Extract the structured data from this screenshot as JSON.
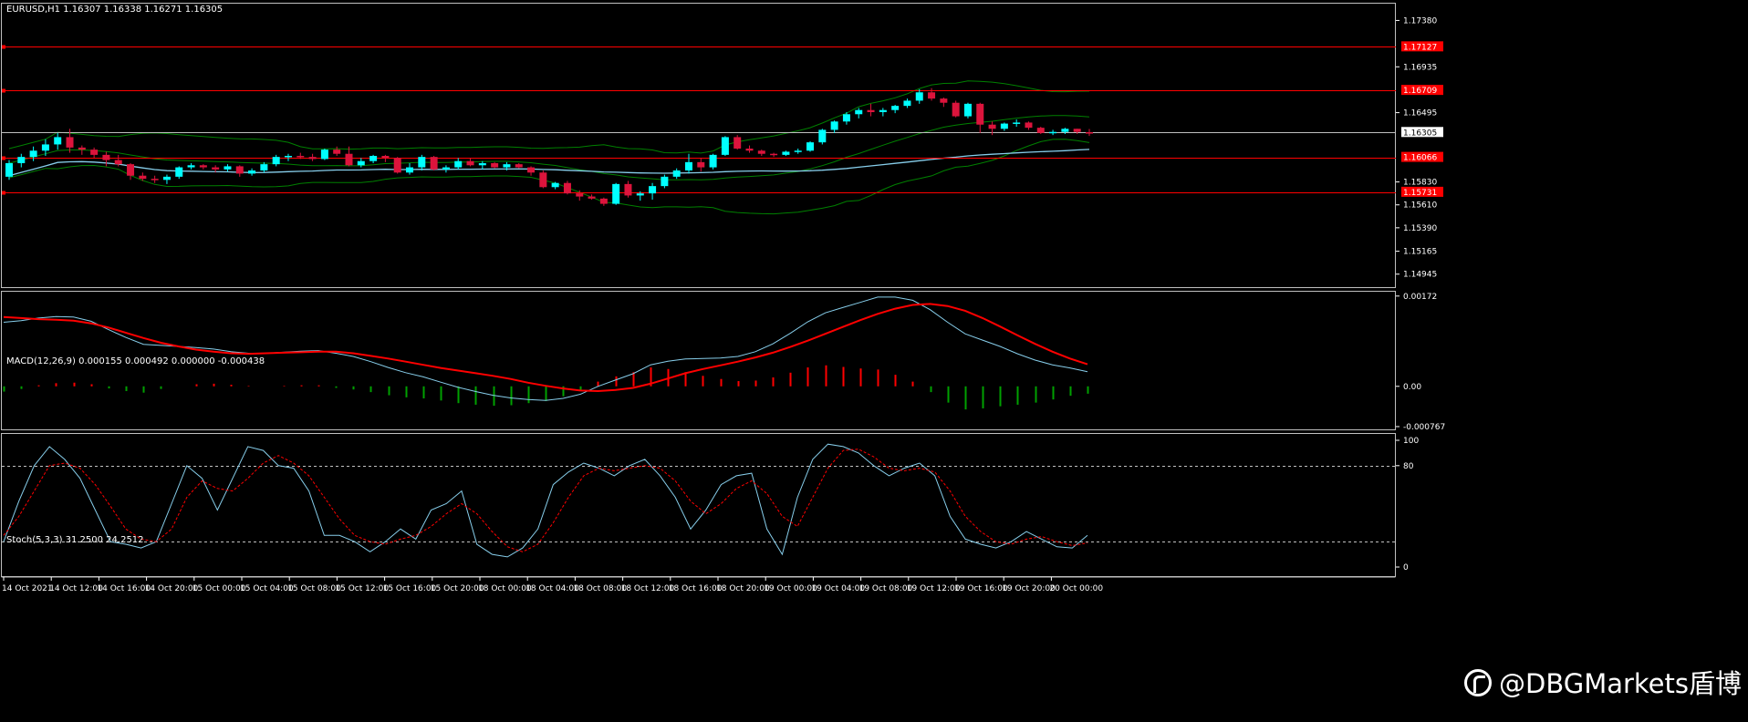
{
  "chart_data": {
    "type": "candlestick",
    "symbol_header": "EURUSD,H1  1.16307 1.16338 1.16271 1.16305",
    "price_panel": {
      "ylim": [
        1.1482,
        1.1755
      ],
      "ticks": [
        "1.17380",
        "1.16935",
        "1.16495",
        "1.15830",
        "1.15610",
        "1.15390",
        "1.15165",
        "1.14945"
      ],
      "tick_values": [
        1.1738,
        1.16935,
        1.16495,
        1.1583,
        1.1561,
        1.1539,
        1.15165,
        1.14945
      ],
      "current_price": "1.16305",
      "current_price_value": 1.16305,
      "level_lines": [
        {
          "label": "1.17127",
          "value": 1.17127
        },
        {
          "label": "1.16709",
          "value": 1.16709
        },
        {
          "label": "1.16066",
          "value": 1.16066
        },
        {
          "label": "1.15731",
          "value": 1.15731
        }
      ],
      "candles_ohlc": [
        [
          1.1588,
          1.1604,
          1.1585,
          1.1601
        ],
        [
          1.1601,
          1.161,
          1.1597,
          1.1607
        ],
        [
          1.1607,
          1.1617,
          1.1603,
          1.1613
        ],
        [
          1.1613,
          1.1624,
          1.1608,
          1.1619
        ],
        [
          1.1619,
          1.163,
          1.1614,
          1.1626
        ],
        [
          1.1626,
          1.1634,
          1.1611,
          1.1616
        ],
        [
          1.1616,
          1.1618,
          1.1609,
          1.1614
        ],
        [
          1.1614,
          1.1616,
          1.1606,
          1.1609
        ],
        [
          1.1609,
          1.1612,
          1.1598,
          1.1604
        ],
        [
          1.1604,
          1.1609,
          1.1598,
          1.16
        ],
        [
          1.16,
          1.1601,
          1.1585,
          1.1589
        ],
        [
          1.1589,
          1.1592,
          1.1584,
          1.1586
        ],
        [
          1.1586,
          1.1589,
          1.1582,
          1.1585
        ],
        [
          1.1585,
          1.159,
          1.1581,
          1.1588
        ],
        [
          1.1588,
          1.1598,
          1.1586,
          1.1597
        ],
        [
          1.1597,
          1.1601,
          1.1595,
          1.1599
        ],
        [
          1.1599,
          1.16,
          1.1595,
          1.1597
        ],
        [
          1.1597,
          1.1599,
          1.1592,
          1.1595
        ],
        [
          1.1595,
          1.16,
          1.1593,
          1.1598
        ],
        [
          1.1598,
          1.1599,
          1.1588,
          1.1591
        ],
        [
          1.1591,
          1.1596,
          1.1589,
          1.1594
        ],
        [
          1.1594,
          1.1602,
          1.1592,
          1.16
        ],
        [
          1.16,
          1.1609,
          1.1598,
          1.1607
        ],
        [
          1.1607,
          1.161,
          1.1603,
          1.1608
        ],
        [
          1.1608,
          1.1611,
          1.1605,
          1.1607
        ],
        [
          1.1607,
          1.161,
          1.1603,
          1.1605
        ],
        [
          1.1605,
          1.1615,
          1.1604,
          1.1614
        ],
        [
          1.1614,
          1.1617,
          1.1608,
          1.161
        ],
        [
          1.161,
          1.1617,
          1.1598,
          1.1599
        ],
        [
          1.1599,
          1.1606,
          1.1597,
          1.1603
        ],
        [
          1.1603,
          1.1609,
          1.1601,
          1.1608
        ],
        [
          1.1608,
          1.1609,
          1.1602,
          1.1606
        ],
        [
          1.1606,
          1.1607,
          1.1591,
          1.1592
        ],
        [
          1.1592,
          1.1601,
          1.159,
          1.1597
        ],
        [
          1.1597,
          1.1609,
          1.1594,
          1.1607
        ],
        [
          1.1607,
          1.1608,
          1.1594,
          1.1595
        ],
        [
          1.1595,
          1.1599,
          1.1592,
          1.1597
        ],
        [
          1.1597,
          1.1606,
          1.1595,
          1.1603
        ],
        [
          1.1603,
          1.1606,
          1.1598,
          1.1599
        ],
        [
          1.1599,
          1.1603,
          1.1595,
          1.1601
        ],
        [
          1.1601,
          1.1602,
          1.1596,
          1.1597
        ],
        [
          1.1597,
          1.1602,
          1.1594,
          1.16
        ],
        [
          1.16,
          1.1601,
          1.1596,
          1.1597
        ],
        [
          1.1597,
          1.1598,
          1.1589,
          1.1592
        ],
        [
          1.1592,
          1.1594,
          1.1577,
          1.1578
        ],
        [
          1.1578,
          1.1583,
          1.1576,
          1.1582
        ],
        [
          1.1582,
          1.1584,
          1.1571,
          1.1572
        ],
        [
          1.1572,
          1.1575,
          1.1565,
          1.1569
        ],
        [
          1.1569,
          1.1571,
          1.1566,
          1.1567
        ],
        [
          1.1567,
          1.1568,
          1.156,
          1.1562
        ],
        [
          1.1562,
          1.1582,
          1.1561,
          1.1581
        ],
        [
          1.1581,
          1.1584,
          1.1568,
          1.157
        ],
        [
          1.157,
          1.1574,
          1.1565,
          1.1572
        ],
        [
          1.1572,
          1.1582,
          1.1566,
          1.1579
        ],
        [
          1.1579,
          1.159,
          1.1577,
          1.1588
        ],
        [
          1.1588,
          1.1596,
          1.1586,
          1.1594
        ],
        [
          1.1594,
          1.161,
          1.1591,
          1.1602
        ],
        [
          1.1602,
          1.1606,
          1.1593,
          1.1597
        ],
        [
          1.1597,
          1.161,
          1.1595,
          1.1609
        ],
        [
          1.1609,
          1.1627,
          1.1608,
          1.1626
        ],
        [
          1.1626,
          1.1628,
          1.1614,
          1.1615
        ],
        [
          1.1615,
          1.1618,
          1.1611,
          1.1613
        ],
        [
          1.1613,
          1.1614,
          1.1608,
          1.161
        ],
        [
          1.161,
          1.1611,
          1.1607,
          1.1609
        ],
        [
          1.1609,
          1.1613,
          1.1608,
          1.1612
        ],
        [
          1.1612,
          1.1615,
          1.161,
          1.1613
        ],
        [
          1.1613,
          1.1622,
          1.1612,
          1.1621
        ],
        [
          1.1621,
          1.1634,
          1.1619,
          1.1633
        ],
        [
          1.1633,
          1.1642,
          1.163,
          1.1641
        ],
        [
          1.1641,
          1.165,
          1.1638,
          1.1648
        ],
        [
          1.1648,
          1.1654,
          1.1644,
          1.1652
        ],
        [
          1.1652,
          1.1658,
          1.1646,
          1.165
        ],
        [
          1.165,
          1.1654,
          1.1646,
          1.1652
        ],
        [
          1.1652,
          1.1657,
          1.1649,
          1.1656
        ],
        [
          1.1656,
          1.1663,
          1.1654,
          1.1661
        ],
        [
          1.1661,
          1.1672,
          1.1658,
          1.1669
        ],
        [
          1.1669,
          1.1673,
          1.1661,
          1.1663
        ],
        [
          1.1663,
          1.1664,
          1.1655,
          1.1659
        ],
        [
          1.1659,
          1.1661,
          1.1645,
          1.1646
        ],
        [
          1.1646,
          1.1659,
          1.1644,
          1.1658
        ],
        [
          1.1658,
          1.1659,
          1.163,
          1.1638
        ],
        [
          1.1638,
          1.1641,
          1.1628,
          1.1634
        ],
        [
          1.1634,
          1.164,
          1.1632,
          1.1639
        ],
        [
          1.1639,
          1.1643,
          1.1636,
          1.164
        ],
        [
          1.164,
          1.1641,
          1.1633,
          1.1635
        ],
        [
          1.1635,
          1.1636,
          1.1629,
          1.163
        ],
        [
          1.163,
          1.1633,
          1.1628,
          1.1631
        ],
        [
          1.1631,
          1.1635,
          1.1629,
          1.1634
        ],
        [
          1.1634,
          1.1634,
          1.1629,
          1.1631
        ],
        [
          1.16307,
          1.16338,
          1.16271,
          1.16305
        ]
      ]
    },
    "macd_panel": {
      "title": "MACD(12,26,9) 0.000155 0.000492 0.000000 -0.000438",
      "ticks": [
        "0.00172",
        "0.00",
        "-0.000767"
      ],
      "tick_values": [
        0.00172,
        0.0,
        -0.000767
      ],
      "ylim": [
        -0.00082,
        0.00182
      ],
      "macd": [
        0.00122,
        0.00125,
        0.0013,
        0.00133,
        0.00132,
        0.00124,
        0.00108,
        0.00093,
        0.0008,
        0.00078,
        0.00076,
        0.00074,
        0.00071,
        0.00066,
        0.00063,
        0.00063,
        0.00065,
        0.00067,
        0.00068,
        0.00063,
        0.00057,
        0.00047,
        0.00036,
        0.00026,
        0.00018,
        8e-05,
        -2e-05,
        -0.0001,
        -0.00017,
        -0.00022,
        -0.00025,
        -0.00027,
        -0.00023,
        -0.00015,
        0.0,
        0.00012,
        0.00024,
        0.00041,
        0.00048,
        0.00052,
        0.00053,
        0.00054,
        0.00057,
        0.00066,
        0.00081,
        0.00101,
        0.00123,
        0.0014,
        0.0015,
        0.0016,
        0.0017,
        0.0017,
        0.00164,
        0.00146,
        0.00122,
        0.001,
        0.00088,
        0.00076,
        0.00062,
        0.0005,
        0.00041,
        0.00035,
        0.00028
      ],
      "signal": [
        0.00132,
        0.0013,
        0.00128,
        0.00127,
        0.00125,
        0.0012,
        0.00112,
        0.00102,
        0.00092,
        0.00083,
        0.00076,
        0.0007,
        0.00066,
        0.00063,
        0.00062,
        0.00063,
        0.00064,
        0.00065,
        0.00066,
        0.00066,
        0.00063,
        0.00058,
        0.00053,
        0.00047,
        0.00041,
        0.00035,
        0.0003,
        0.00025,
        0.0002,
        0.00014,
        7e-05,
        1e-05,
        -4e-05,
        -8e-05,
        -9e-05,
        -7e-05,
        -3e-05,
        5e-05,
        0.00015,
        0.00025,
        0.00033,
        0.0004,
        0.00047,
        0.00055,
        0.00064,
        0.00075,
        0.00087,
        0.001,
        0.00113,
        0.00126,
        0.00138,
        0.00148,
        0.00155,
        0.00157,
        0.00153,
        0.00144,
        0.0013,
        0.00114,
        0.00097,
        0.00081,
        0.00066,
        0.00053,
        0.00042
      ],
      "histogram": [
        -0.0001,
        -5e-05,
        2e-05,
        6e-05,
        7e-05,
        4e-05,
        -4e-05,
        -9e-05,
        -0.00012,
        -5e-05,
        0.0,
        4e-05,
        5e-05,
        3e-05,
        1e-05,
        0.0,
        1e-05,
        2e-05,
        2e-05,
        -3e-05,
        -6e-05,
        -0.00011,
        -0.00017,
        -0.00021,
        -0.00023,
        -0.00027,
        -0.00032,
        -0.00035,
        -0.00037,
        -0.00036,
        -0.00032,
        -0.00028,
        -0.00019,
        -7e-05,
        9e-05,
        0.00019,
        0.00027,
        0.00036,
        0.00033,
        0.00027,
        0.0002,
        0.00014,
        0.0001,
        0.00011,
        0.00017,
        0.00026,
        0.00036,
        0.0004,
        0.00037,
        0.00034,
        0.00032,
        0.00022,
        9e-05,
        -0.00011,
        -0.00031,
        -0.00044,
        -0.00042,
        -0.00038,
        -0.00035,
        -0.00031,
        -0.00025,
        -0.00018,
        -0.00014
      ]
    },
    "stoch_panel": {
      "title": "Stoch(5,3,3) 31.2500 24.2512",
      "ticks": [
        "100",
        "80",
        "0"
      ],
      "tick_values": [
        100,
        80,
        0
      ],
      "levels": [
        80,
        20
      ],
      "ylim": [
        0,
        100
      ],
      "main": [
        20,
        52,
        80,
        95,
        85,
        70,
        45,
        20,
        18,
        15,
        20,
        50,
        80,
        70,
        45,
        70,
        95,
        92,
        80,
        78,
        60,
        25,
        25,
        20,
        12,
        20,
        30,
        22,
        45,
        50,
        60,
        18,
        10,
        8,
        15,
        30,
        65,
        75,
        82,
        78,
        72,
        80,
        85,
        72,
        55,
        30,
        45,
        65,
        72,
        74,
        30,
        10,
        55,
        85,
        97,
        95,
        90,
        80,
        72,
        78,
        82,
        72,
        40,
        22,
        18,
        15,
        20,
        28,
        22,
        16,
        15,
        25
      ],
      "signal": [
        25,
        40,
        60,
        80,
        82,
        78,
        65,
        48,
        30,
        22,
        20,
        30,
        55,
        68,
        62,
        60,
        70,
        82,
        88,
        82,
        72,
        55,
        38,
        25,
        20,
        18,
        22,
        25,
        32,
        42,
        50,
        42,
        28,
        16,
        12,
        18,
        35,
        55,
        72,
        78,
        76,
        78,
        80,
        78,
        68,
        52,
        42,
        50,
        62,
        68,
        58,
        40,
        32,
        55,
        78,
        92,
        93,
        87,
        78,
        76,
        78,
        75,
        60,
        40,
        28,
        20,
        18,
        22,
        24,
        20,
        17,
        19
      ]
    },
    "x_tick_labels": [
      "14 Oct 2021",
      "14 Oct 12:00",
      "14 Oct 16:00",
      "14 Oct 20:00",
      "15 Oct 00:00",
      "15 Oct 04:00",
      "15 Oct 08:00",
      "15 Oct 12:00",
      "15 Oct 16:00",
      "15 Oct 20:00",
      "18 Oct 00:00",
      "18 Oct 04:00",
      "18 Oct 08:00",
      "18 Oct 12:00",
      "18 Oct 16:00",
      "18 Oct 20:00",
      "19 Oct 00:00",
      "19 Oct 04:00",
      "19 Oct 08:00",
      "19 Oct 12:00",
      "19 Oct 16:00",
      "19 Oct 20:00",
      "20 Oct 00:00"
    ],
    "colors": {
      "bull": "#00ffff",
      "bear": "#dc143c",
      "macd_line": "#87ceeb",
      "signal_line": "#ff0000",
      "hist_pos": "#ff0000",
      "hist_neg": "#00a000",
      "bands": "#008000",
      "ma": "#87ceeb",
      "levels": "#ff0000",
      "grid": "#c0c0c0"
    }
  },
  "watermark": "@DBGMarkets盾博"
}
